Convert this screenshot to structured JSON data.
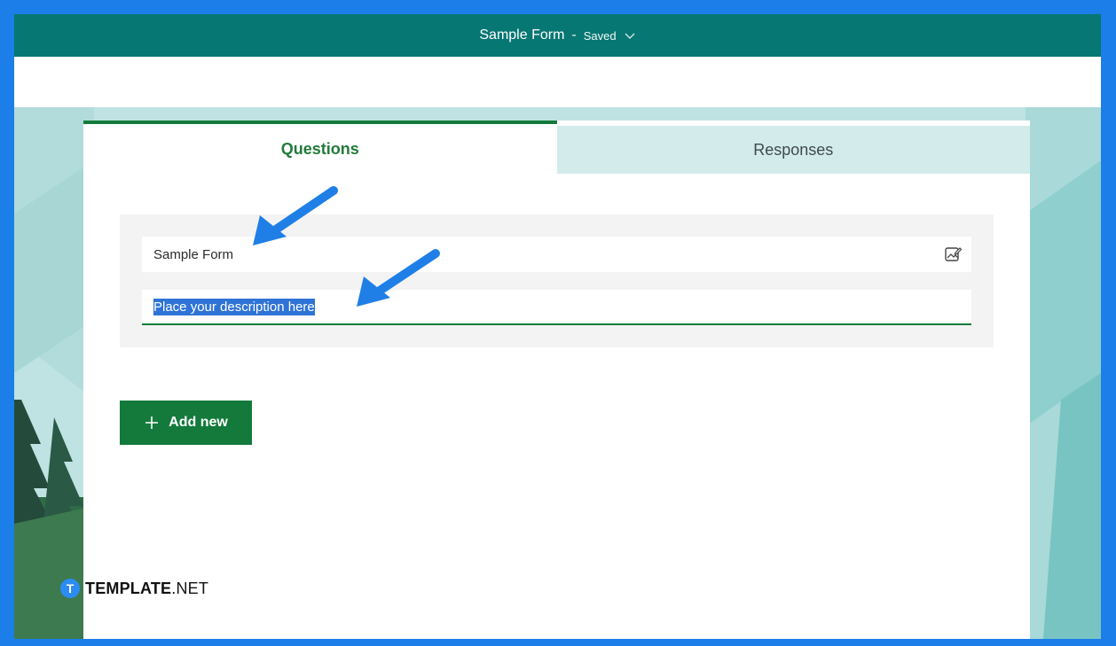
{
  "topbar": {
    "form_title": "Sample Form",
    "separator": "-",
    "status": "Saved"
  },
  "tabs": [
    {
      "label": "Questions",
      "active": true
    },
    {
      "label": "Responses",
      "active": false
    }
  ],
  "form_header": {
    "title_value": "Sample Form",
    "description_value": "Place your description here"
  },
  "actions": {
    "add_new_label": "Add new"
  },
  "watermark": {
    "badge_letter": "T",
    "brand_bold": "TEMPLATE",
    "brand_rest": ".NET"
  },
  "colors": {
    "topbar": "#077773",
    "accent_green": "#137a3b",
    "frame_border": "#1c7ee8",
    "annotation_arrow": "#1f7fe6",
    "selection": "#2f73d6"
  },
  "icons": {
    "title_image": "insert-image-icon",
    "status_dropdown": "chevron-down-icon",
    "add": "plus-icon"
  }
}
